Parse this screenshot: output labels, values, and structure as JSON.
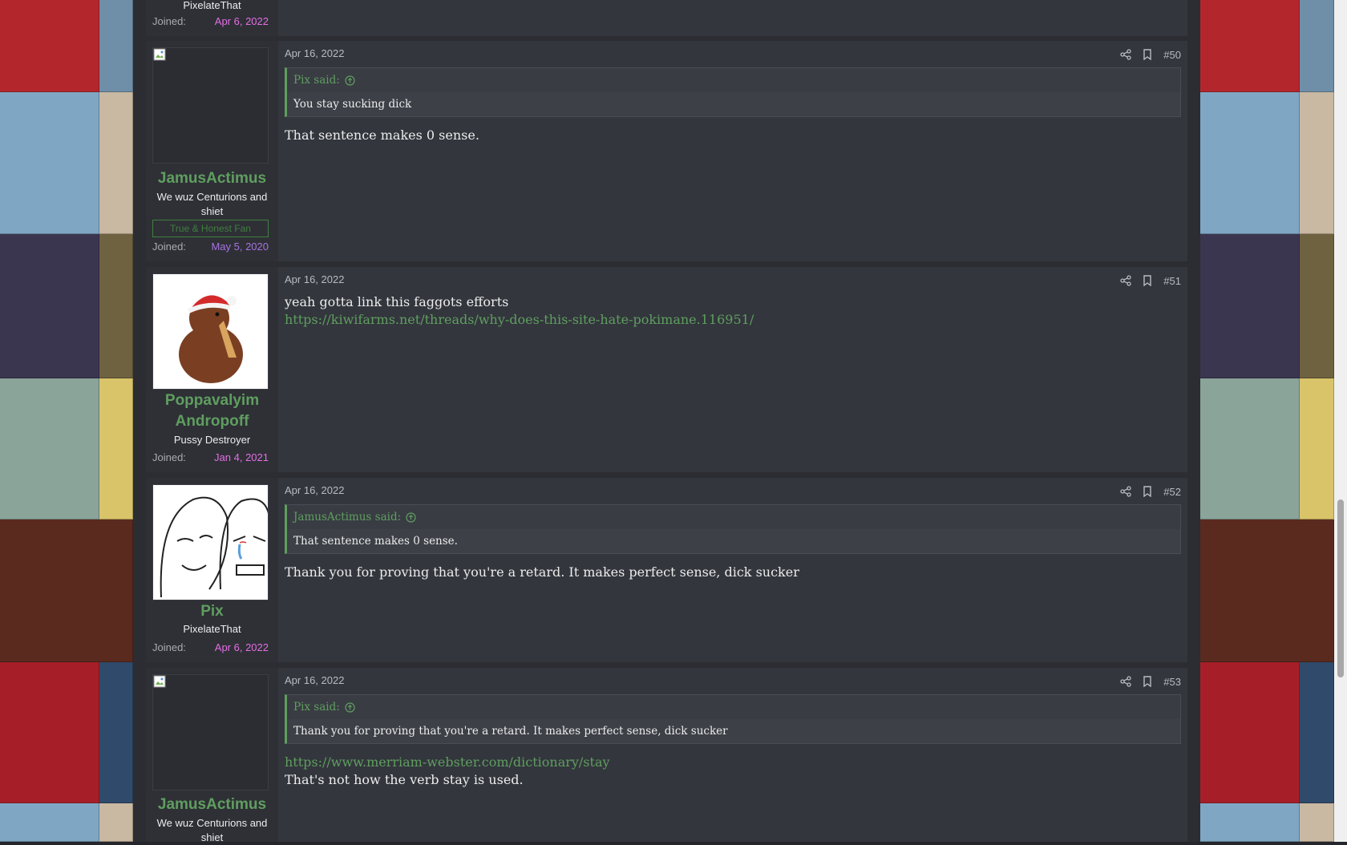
{
  "colors": {
    "username": "#5f9e5f",
    "link": "#5f9e5f",
    "joined_pink": "#e36ee3",
    "joined_purple": "#a872e0",
    "post_bg": "#33363d"
  },
  "top_partial_post": {
    "user_title": "PixelateThat",
    "joined_label": "Joined:",
    "joined_date": "Apr 6, 2022"
  },
  "posts": [
    {
      "number": "#50",
      "date": "Apr 16, 2022",
      "username": "JamusActimus",
      "user_title": "We wuz Centurions and shiet",
      "banner": "True & Honest Fan",
      "joined_label": "Joined:",
      "joined_date": "May 5, 2020",
      "avatar_icon": "broken-image-icon",
      "quote_author": "Pix said:",
      "quote_text": "You stay sucking dick",
      "message": "That sentence makes 0 sense."
    },
    {
      "number": "#51",
      "date": "Apr 16, 2022",
      "username_line1": "Poppavalyim",
      "username_line2": "Andropoff",
      "user_title": "Pussy Destroyer",
      "joined_label": "Joined:",
      "joined_date": "Jan 4, 2021",
      "avatar_icon": "kiwi-bird-santa-hat-icon",
      "message": "yeah gotta link this faggots efforts",
      "link": "https://kiwifarms.net/threads/why-does-this-site-hate-pokimane.116951/"
    },
    {
      "number": "#52",
      "date": "Apr 16, 2022",
      "username": "Pix",
      "user_title": "PixelateThat",
      "joined_label": "Joined:",
      "joined_date": "Apr 6, 2022",
      "avatar_icon": "wojak-meme-icon",
      "quote_author": "JamusActimus said:",
      "quote_text": "That sentence makes 0 sense.",
      "message": "Thank you for proving that you're a retard. It makes perfect sense, dick sucker"
    },
    {
      "number": "#53",
      "date": "Apr 16, 2022",
      "username": "JamusActimus",
      "user_title": "We wuz Centurions and shiet",
      "avatar_icon": "broken-image-icon",
      "quote_author": "Pix said:",
      "quote_text": "Thank you for proving that you're a retard. It makes perfect sense, dick sucker",
      "link": "https://www.merriam-webster.com/dictionary/stay",
      "message": "That's not how the verb stay is used."
    }
  ],
  "icons": {
    "share": "share-icon",
    "bookmark": "bookmark-icon",
    "quote_jump": "arrow-up-circle-icon"
  }
}
